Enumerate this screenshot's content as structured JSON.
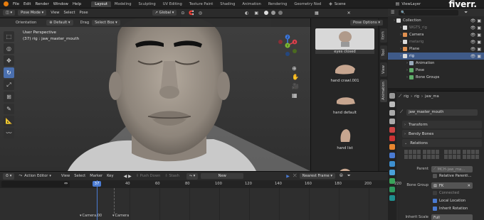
{
  "topbar": {
    "menus": [
      "File",
      "Edit",
      "Render",
      "Window",
      "Help"
    ],
    "workspaces": [
      "Layout",
      "Modeling",
      "Sculpting",
      "UV Editing",
      "Texture Paint",
      "Shading",
      "Animation",
      "Rendering",
      "Geometry Nod"
    ],
    "active_workspace": "Layout",
    "scene": "Scene",
    "view_layer": "ViewLayer",
    "watermark": "fiverr."
  },
  "viewport_header": {
    "mode": "Pose Mode",
    "menus": [
      "View",
      "Select",
      "Pose"
    ],
    "transform": "Global",
    "pose_options": "Pose Options"
  },
  "tool_settings": {
    "orientation_label": "Orientation",
    "orientation_value": "Default",
    "drag_label": "Drag",
    "drag_value": "Select Box"
  },
  "viewport": {
    "view_name": "User Perspective",
    "object_info": "(37) rig : jaw_master_mouth",
    "gizmo": {
      "x": "X",
      "y": "Y",
      "z": "Z"
    },
    "colors": {
      "background": "#3a3a3a",
      "x_axis": "#e0424e",
      "y_axis": "#7fbb32",
      "z_axis": "#3d7be5"
    }
  },
  "tools": [
    "select-box",
    "cursor",
    "move",
    "rotate",
    "scale",
    "transform",
    "annotate",
    "measure",
    "relax"
  ],
  "assets": [
    {
      "label": "eyes closed",
      "selected": true
    },
    {
      "label": "hand crawl.001",
      "selected": false
    },
    {
      "label": "hand default",
      "selected": false
    },
    {
      "label": "hand list",
      "selected": false
    }
  ],
  "side_tabs": [
    "Item",
    "Tool",
    "View",
    "Animation"
  ],
  "outliner": {
    "search_placeholder": "",
    "rows": [
      {
        "label": "Collection",
        "indent": 0,
        "dim": false,
        "sel": false,
        "icon": "collection-icon"
      },
      {
        "label": "WGTS_rig",
        "indent": 1,
        "dim": true,
        "sel": false,
        "icon": "collection-icon"
      },
      {
        "label": "Camera",
        "indent": 1,
        "dim": false,
        "sel": false,
        "icon": "camera-icon"
      },
      {
        "label": "metarig",
        "indent": 1,
        "dim": true,
        "sel": false,
        "icon": "armature-icon"
      },
      {
        "label": "Plane",
        "indent": 1,
        "dim": false,
        "sel": false,
        "icon": "mesh-icon"
      },
      {
        "label": "rig",
        "indent": 1,
        "dim": false,
        "sel": true,
        "icon": "armature-icon"
      },
      {
        "label": "Animation",
        "indent": 2,
        "dim": false,
        "sel": false,
        "icon": "action-icon"
      },
      {
        "label": "Pose",
        "indent": 2,
        "dim": false,
        "sel": false,
        "icon": "pose-icon"
      },
      {
        "label": "Bone Groups",
        "indent": 2,
        "dim": false,
        "sel": false,
        "icon": "bone-group-icon"
      }
    ]
  },
  "properties": {
    "breadcrumb": [
      "rig",
      "rig",
      "jaw_ma"
    ],
    "bone_name": "jaw_master_mouth",
    "panels": {
      "transform": "Transform",
      "bendy_bones": "Bendy Bones",
      "relations": "Relations"
    },
    "parent_label": "Parent",
    "parent_value": "MCH-jaw_ma...",
    "relative_parenting": "Relative Parenti...",
    "bone_group_label": "Bone Group",
    "bone_group_value": "FK",
    "connected": "Connected",
    "local_location": "Local Location",
    "inherit_rotation": "Inherit Rotation",
    "inherit_scale_label": "Inherit Scale",
    "inherit_scale_value": "Full"
  },
  "action_editor": {
    "editor": "Action Editor",
    "menus": [
      "View",
      "Select",
      "Marker",
      "Key"
    ],
    "push_down": "Push Down",
    "stash": "Stash",
    "new_button": "New",
    "snapping": "Nearest Frame",
    "current_frame": "37",
    "ticks": [
      "40",
      "60",
      "80",
      "100",
      "120",
      "140",
      "160",
      "180",
      "200",
      "220"
    ],
    "markers": [
      "Camera.00",
      "Camera"
    ]
  }
}
